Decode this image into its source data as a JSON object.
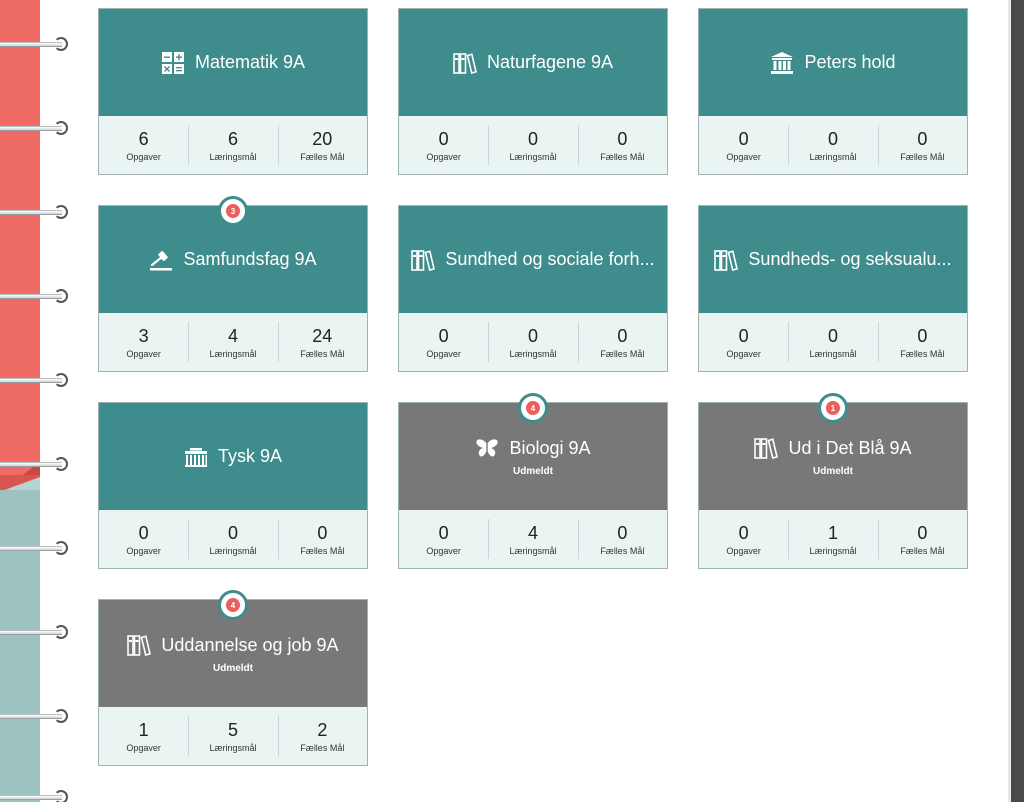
{
  "colors": {
    "teal": "#3f8c8c",
    "grey": "#787878",
    "badge": "#e9615c",
    "stats_bg": "#eaf4f3"
  },
  "stat_labels": {
    "tasks": "Opgaver",
    "goals": "Læringsmål",
    "common": "Fælles Mål"
  },
  "status_label": "Udmeldt",
  "cards": [
    {
      "title": "Matematik 9A",
      "icon": "calculator-icon",
      "status": "",
      "badge": "",
      "tasks": "6",
      "goals": "6",
      "common": "20"
    },
    {
      "title": "Naturfagene 9A",
      "icon": "books-icon",
      "status": "",
      "badge": "",
      "tasks": "0",
      "goals": "0",
      "common": "0"
    },
    {
      "title": "Peters hold",
      "icon": "museum-icon",
      "status": "",
      "badge": "",
      "tasks": "0",
      "goals": "0",
      "common": "0"
    },
    {
      "title": "Samfundsfag 9A",
      "icon": "gavel-icon",
      "status": "",
      "badge": "3",
      "tasks": "3",
      "goals": "4",
      "common": "24"
    },
    {
      "title": "Sundhed og sociale forh...",
      "icon": "books-icon",
      "status": "",
      "badge": "",
      "tasks": "0",
      "goals": "0",
      "common": "0"
    },
    {
      "title": "Sundheds- og seksualu...",
      "icon": "books-icon",
      "status": "",
      "badge": "",
      "tasks": "0",
      "goals": "0",
      "common": "0"
    },
    {
      "title": "Tysk 9A",
      "icon": "brandenburg-gate-icon",
      "status": "",
      "badge": "",
      "tasks": "0",
      "goals": "0",
      "common": "0"
    },
    {
      "title": "Biologi 9A",
      "icon": "butterfly-icon",
      "status": "Udmeldt",
      "badge": "4",
      "tasks": "0",
      "goals": "4",
      "common": "0"
    },
    {
      "title": "Ud i Det Blå 9A",
      "icon": "books-icon",
      "status": "Udmeldt",
      "badge": "1",
      "tasks": "0",
      "goals": "1",
      "common": "0"
    },
    {
      "title": "Uddannelse og job 9A",
      "icon": "books-icon",
      "status": "Udmeldt",
      "badge": "4",
      "tasks": "1",
      "goals": "5",
      "common": "2"
    }
  ]
}
